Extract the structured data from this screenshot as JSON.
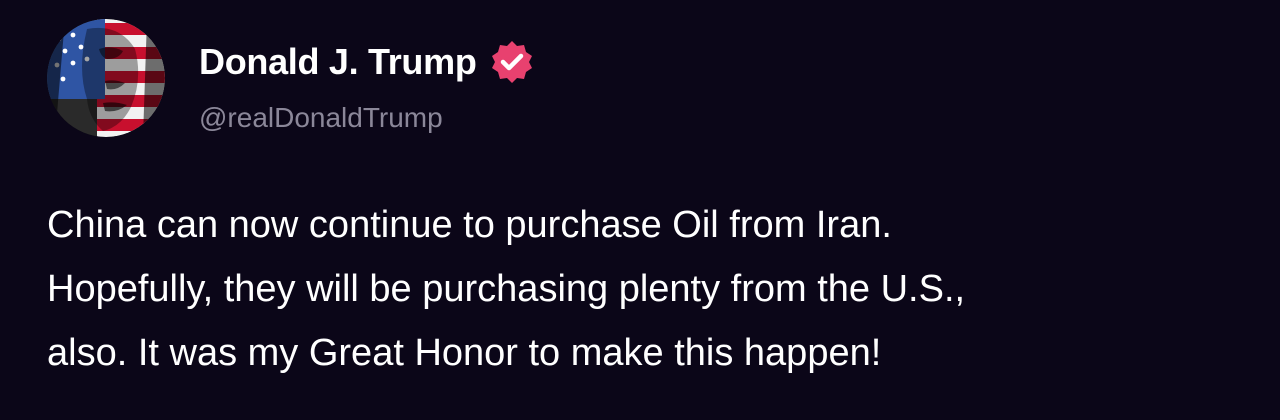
{
  "author": {
    "display_name": "Donald J. Trump",
    "handle": "@realDonaldTrump",
    "avatar_icon": "flag-portrait-avatar",
    "verified_icon": "verified-badge-icon",
    "verified_color": "#e8416f"
  },
  "post": {
    "lines": [
      "China can now continue to purchase Oil from Iran.",
      "Hopefully, they will be purchasing plenty from the U.S.,",
      "also. It was my Great Honor to make this happen!"
    ]
  },
  "colors": {
    "background": "#0b0618",
    "text": "#ffffff",
    "handle": "#8b8799"
  }
}
